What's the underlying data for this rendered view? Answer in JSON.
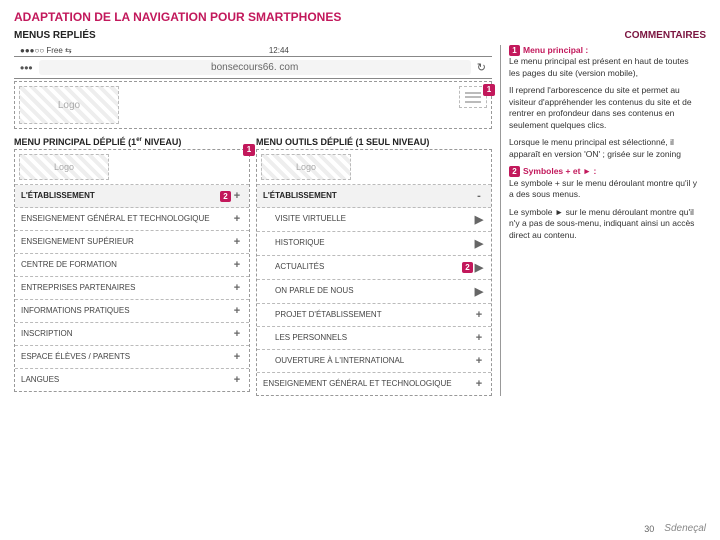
{
  "page": {
    "title": "ADAPTATION DE LA NAVIGATION POUR SMARTPHONES",
    "subtitle": "MENUS REPLIÉS",
    "comments_header": "COMMENTAIRES",
    "page_number": "30",
    "brand": "Sdeneçal"
  },
  "browser": {
    "status_left": "●●●○○ Free ⇆",
    "status_time": "12:44",
    "dots": "•••",
    "address": "bonsecours66. com",
    "reload": "↻"
  },
  "collapsed": {
    "logo": "Logo",
    "marker": "1"
  },
  "left_col": {
    "heading": "MENU PRINCIPAL DÉPLIÉ (1",
    "heading_sup": "er",
    "heading_end": " NIVEAU)",
    "marker": "1",
    "logo": "Logo",
    "items": [
      {
        "label": "L'ÉTABLISSEMENT",
        "symbol": "+",
        "selected": true,
        "badge": "2"
      },
      {
        "label": "ENSEIGNEMENT GÉNÉRAL ET TECHNOLOGIQUE",
        "symbol": "+"
      },
      {
        "label": "ENSEIGNEMENT SUPÉRIEUR",
        "symbol": "+"
      },
      {
        "label": "CENTRE DE FORMATION",
        "symbol": "+"
      },
      {
        "label": "ENTREPRISES PARTENAIRES",
        "symbol": "+"
      },
      {
        "label": "INFORMATIONS PRATIQUES",
        "symbol": "+"
      },
      {
        "label": "INSCRIPTION",
        "symbol": "+"
      },
      {
        "label": "ESPACE ÉLÈVES / PARENTS",
        "symbol": "+"
      },
      {
        "label": "LANGUES",
        "symbol": "+"
      }
    ]
  },
  "right_col": {
    "heading": "MENU OUTILS DÉPLIÉ (1 SEUL NIVEAU)",
    "logo": "Logo",
    "items": [
      {
        "label": "L'ÉTABLISSEMENT",
        "symbol": "-",
        "selected": true
      },
      {
        "label": "VISITE VIRTUELLE",
        "symbol": "▶",
        "sub": true
      },
      {
        "label": "HISTORIQUE",
        "symbol": "▶",
        "sub": true
      },
      {
        "label": "ACTUALITÉS",
        "symbol": "▶",
        "sub": true,
        "badge": "2"
      },
      {
        "label": "ON PARLE DE NOUS",
        "symbol": "▶",
        "sub": true
      },
      {
        "label": "PROJET D'ÉTABLISSEMENT",
        "symbol": "+",
        "sub": true
      },
      {
        "label": "LES PERSONNELS",
        "symbol": "+",
        "sub": true
      },
      {
        "label": "OUVERTURE À L'INTERNATIONAL",
        "symbol": "+",
        "sub": true
      },
      {
        "label": "ENSEIGNEMENT GÉNÉRAL ET TECHNOLOGIQUE",
        "symbol": "+"
      }
    ]
  },
  "comments": {
    "n1": "1",
    "c1_title": "Menu principal :",
    "c1_p1": "Le menu principal est présent en haut de toutes les pages du site (version mobile),",
    "c1_p2": "Il reprend l'arborescence du site et permet au visiteur d'appréhender les contenus du site et de rentrer en profondeur dans ses contenus en seulement quelques clics.",
    "c1_p3": "Lorsque le menu principal est sélectionné, il apparaît en version 'ON' ; grisée sur le zoning",
    "n2": "2",
    "c2_title": "Symboles + et ► :",
    "c2_p1": "Le symbole + sur le menu déroulant montre qu'il y a des sous menus.",
    "c2_p2": "Le symbole ► sur le menu déroulant montre qu'il n'y a pas de sous-menu, indiquant ainsi un accès direct au contenu."
  }
}
